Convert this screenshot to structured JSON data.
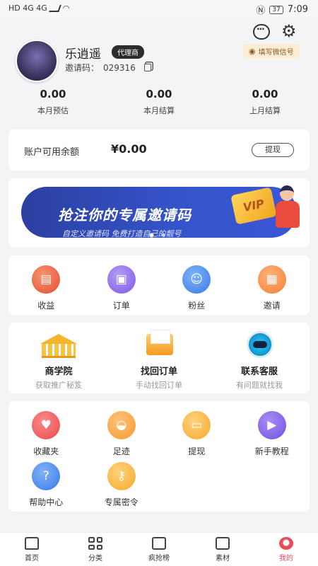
{
  "status_bar": {
    "left": "HD 4G 4G",
    "battery": "37",
    "time": "7:09"
  },
  "profile": {
    "name": "乐逍遥",
    "badge": "代理商",
    "invite_label": "邀请码：",
    "invite_code": "029316",
    "wechat_button": "填写微信号"
  },
  "stats": [
    {
      "value": "0.00",
      "label": "本月预估"
    },
    {
      "value": "0.00",
      "label": "本月结算"
    },
    {
      "value": "0.00",
      "label": "上月结算"
    }
  ],
  "balance": {
    "label": "账户可用余额",
    "value": "¥0.00",
    "button": "提现"
  },
  "banner": {
    "title": "抢注你的专属邀请码",
    "subtitle": "自定义邀请码 免费打造自己的靓号",
    "vip": "VIP"
  },
  "quick_menu": [
    {
      "label": "收益",
      "icon": "wallet-icon"
    },
    {
      "label": "订单",
      "icon": "order-icon"
    },
    {
      "label": "粉丝",
      "icon": "fans-icon"
    },
    {
      "label": "邀请",
      "icon": "gift-icon"
    }
  ],
  "feature_menu": [
    {
      "title": "商学院",
      "sub": "获取推广秘笈",
      "icon": "school-icon"
    },
    {
      "title": "找回订单",
      "sub": "手动找回订单",
      "icon": "envelope-icon"
    },
    {
      "title": "联系客服",
      "sub": "有问题就找我",
      "icon": "robot-icon"
    }
  ],
  "tools_menu": [
    {
      "label": "收藏夹",
      "icon": "heart-icon"
    },
    {
      "label": "足迹",
      "icon": "footprint-icon"
    },
    {
      "label": "提现",
      "icon": "withdraw-icon"
    },
    {
      "label": "新手教程",
      "icon": "play-icon"
    },
    {
      "label": "帮助中心",
      "icon": "help-icon"
    },
    {
      "label": "专属密令",
      "icon": "key-icon"
    }
  ],
  "tabbar": [
    {
      "label": "首页",
      "icon": "home-icon"
    },
    {
      "label": "分类",
      "icon": "grid-icon"
    },
    {
      "label": "疯抢榜",
      "icon": "rank-icon"
    },
    {
      "label": "素材",
      "icon": "material-icon"
    },
    {
      "label": "我的",
      "icon": "me-icon",
      "active": true
    }
  ]
}
